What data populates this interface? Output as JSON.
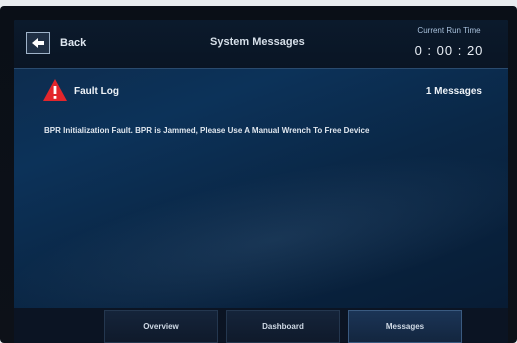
{
  "header": {
    "back_label": "Back",
    "title": "System Messages",
    "runtime_label": "Current Run Time",
    "runtime_value": "0 : 00 : 20"
  },
  "fault_log": {
    "title": "Fault Log",
    "count_text": "1 Messages",
    "icon": "warning-triangle-icon",
    "icon_color": "#e2262c"
  },
  "messages": [
    {
      "text": "BPR Initialization Fault. BPR is Jammed, Please Use A Manual Wrench To Free Device"
    }
  ],
  "nav": {
    "tabs": [
      {
        "label": "Overview"
      },
      {
        "label": "Dashboard"
      },
      {
        "label": "Messages",
        "active": true
      }
    ]
  },
  "colors": {
    "screen_bg": "#0c3259",
    "header_bg": "#0b1a2c",
    "active_tab": "#1b3456"
  }
}
